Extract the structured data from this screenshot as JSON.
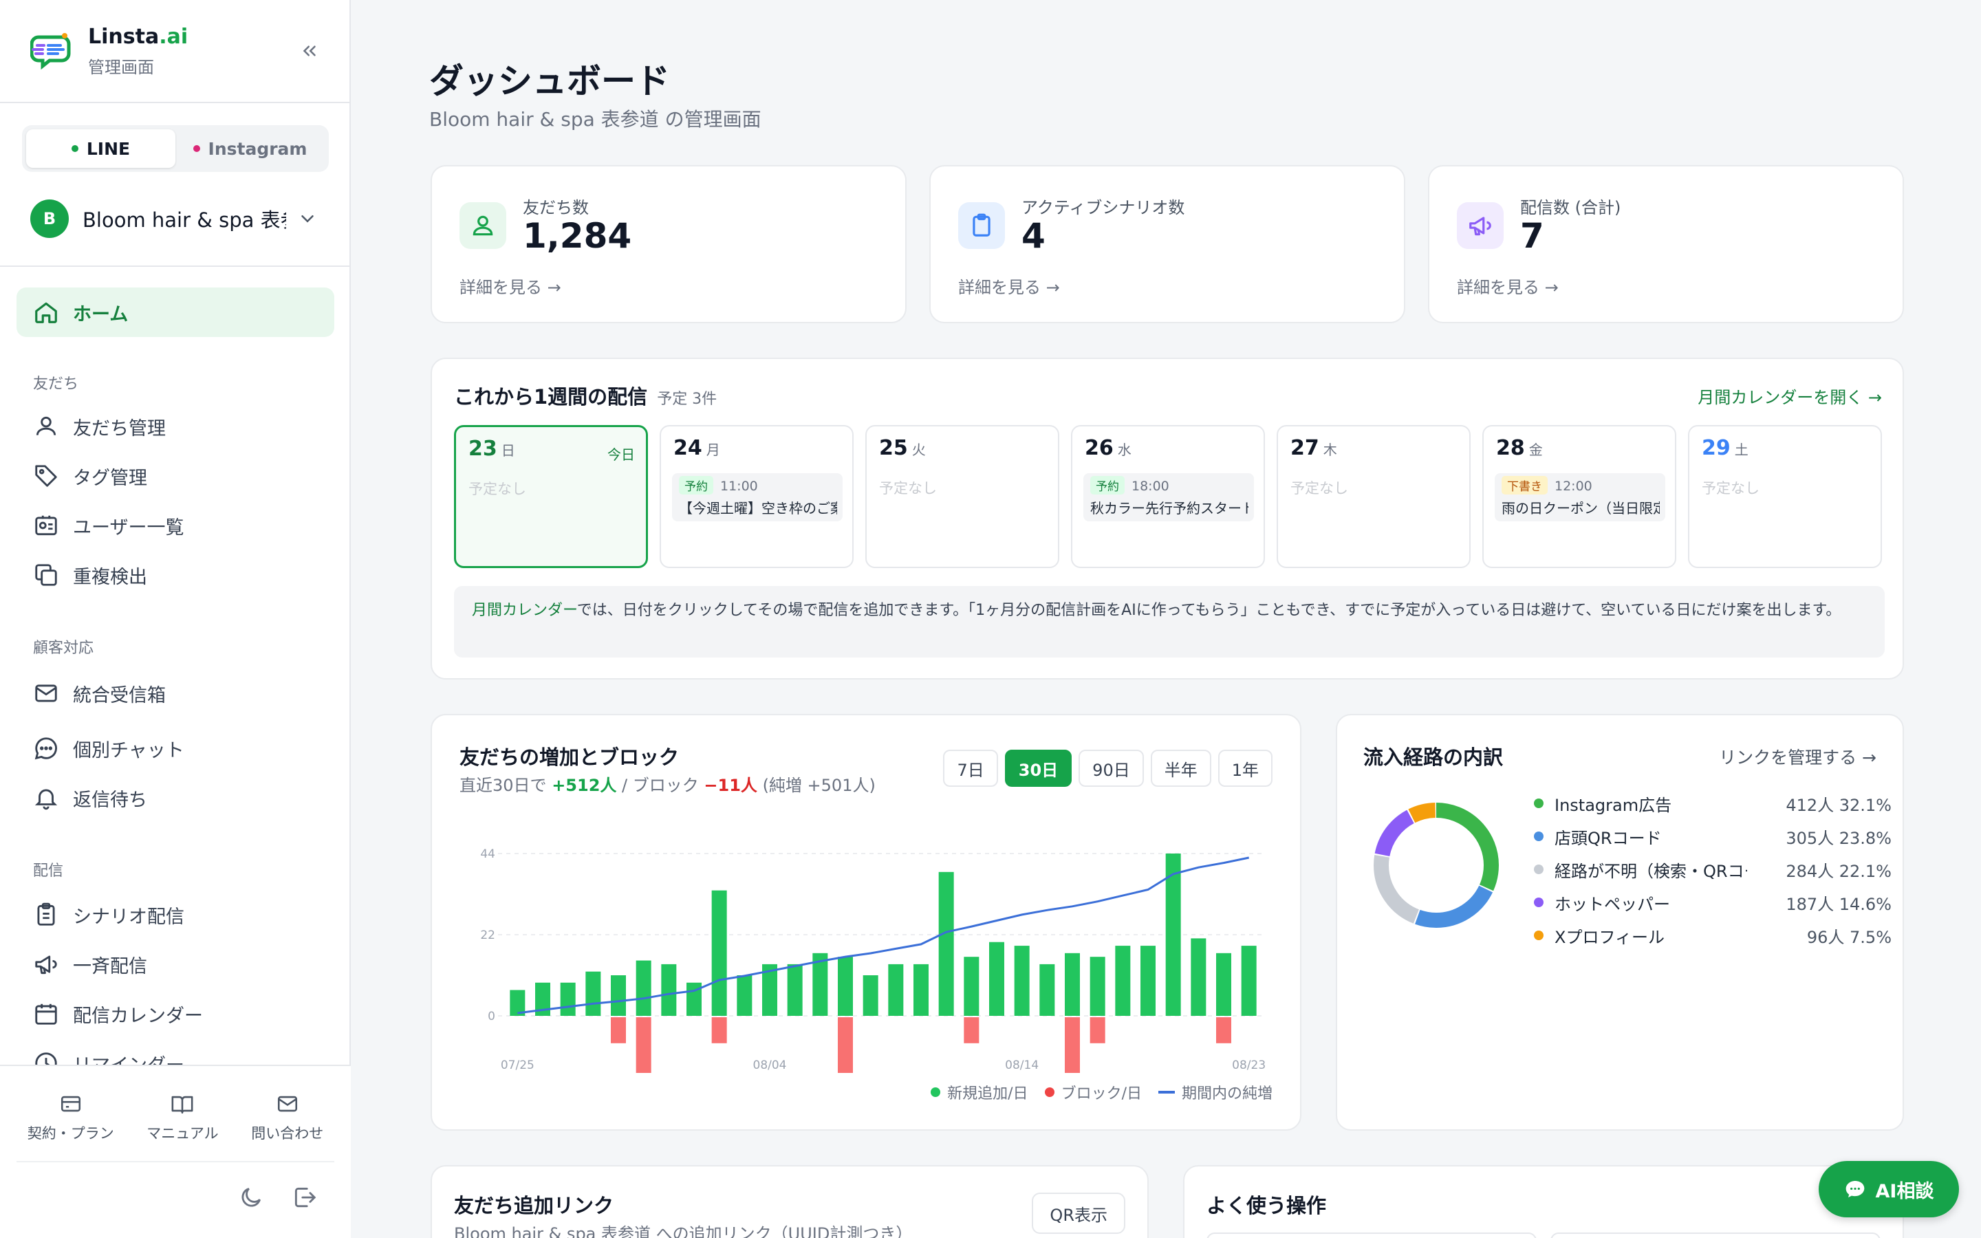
{
  "brand": {
    "name": "Linsta",
    "name_suffix": ".ai",
    "subtitle": "管理画面"
  },
  "channels": [
    {
      "label": "LINE",
      "color": "#16a34a"
    },
    {
      "label": "Instagram",
      "color": "#db2777"
    }
  ],
  "account": {
    "initial": "B",
    "name": "Bloom hair & spa 表参道"
  },
  "nav": {
    "home": "ホーム",
    "sections": {
      "friends": "友だち",
      "support": "顧客対応",
      "delivery": "配信"
    },
    "items": {
      "friend_manage": "友だち管理",
      "tag_manage": "タグ管理",
      "user_list": "ユーザー一覧",
      "duplicate": "重複検出",
      "inbox": "統合受信箱",
      "chat": "個別チャット",
      "waiting": "返信待ち",
      "scenario": "シナリオ配信",
      "broadcast": "一斉配信",
      "calendar": "配信カレンダー",
      "reminder": "リマインダー"
    }
  },
  "footer": {
    "contract": "契約・プラン",
    "manual": "マニュアル",
    "contact": "問い合わせ"
  },
  "page": {
    "title": "ダッシュボード",
    "subtitle": "Bloom hair & spa 表参道 の管理画面"
  },
  "stats": [
    {
      "label": "友だち数",
      "value": "1,284",
      "link": "詳細を見る →",
      "icon": "users-icon",
      "color": "#16a34a"
    },
    {
      "label": "アクティブシナリオ数",
      "value": "4",
      "link": "詳細を見る →",
      "icon": "clipboard-icon",
      "color": "#3b82f6"
    },
    {
      "label": "配信数 (合計)",
      "value": "7",
      "link": "詳細を見る →",
      "icon": "megaphone-icon",
      "color": "#8b5cf6"
    }
  ],
  "week": {
    "title": "これから1週間の配信",
    "meta": "予定 3件",
    "calendar_link": "月間カレンダーを開く →",
    "today_label": "今日",
    "empty_label": "予定なし",
    "days": [
      {
        "num": "23",
        "dow": "日",
        "today": true,
        "num_color": "#15803d"
      },
      {
        "num": "24",
        "dow": "月",
        "event": {
          "tag": "予約",
          "type": "yoyaku",
          "time": "11:00",
          "title": "【今週土曜】空き枠のご案内"
        }
      },
      {
        "num": "25",
        "dow": "火"
      },
      {
        "num": "26",
        "dow": "水",
        "event": {
          "tag": "予約",
          "type": "yoyaku",
          "time": "18:00",
          "title": "秋カラー先行予約スタート"
        }
      },
      {
        "num": "27",
        "dow": "木"
      },
      {
        "num": "28",
        "dow": "金",
        "event": {
          "tag": "下書き",
          "type": "draft",
          "time": "12:00",
          "title": "雨の日クーポン（当日限定）"
        }
      },
      {
        "num": "29",
        "dow": "土",
        "num_color": "#3b82f6"
      }
    ],
    "info": {
      "link": "月間カレンダー",
      "text": "では、日付をクリックしてその場で配信を追加できます。「1ヶ月分の配信計画をAIに作ってもらう」こともでき、すでに予定が入っている日は避けて、空いている日にだけ案を出します。"
    }
  },
  "growth": {
    "title": "友だちの増加とブロック",
    "summary_prefix": "直近30日で",
    "added": "+512人",
    "block_prefix": "/ ブロック",
    "blocked": "−11人",
    "net": "(純増 +501人)",
    "ranges": [
      "7日",
      "30日",
      "90日",
      "半年",
      "1年"
    ],
    "active_range": "30日",
    "legend": {
      "added": "新規追加/日",
      "blocked": "ブロック/日",
      "net": "期間内の純増"
    }
  },
  "sources": {
    "title": "流入経路の内訳",
    "link": "リンクを管理する →",
    "items": [
      {
        "name": "Instagram広告",
        "value": "412人 32.1%",
        "color": "#3bb54a",
        "pct": 32.1
      },
      {
        "name": "店頭QRコード",
        "value": "305人 23.8%",
        "color": "#4a8fe0",
        "pct": 23.8
      },
      {
        "name": "経路が不明（検索・QRコード等）",
        "value": "284人 22.1%",
        "color": "#c7ccd3",
        "pct": 22.1
      },
      {
        "name": "ホットペッパー",
        "value": "187人 14.6%",
        "color": "#8b5cf6",
        "pct": 14.6
      },
      {
        "name": "Xプロフィール",
        "value": "96人 7.5%",
        "color": "#f59e0b",
        "pct": 7.5
      }
    ]
  },
  "links_card": {
    "title": "友だち追加リンク",
    "subtitle": "Bloom hair & spa 表参道 への追加リンク（UUID計測つき）",
    "qr_button": "QR表示"
  },
  "quick_ops": {
    "title": "よく使う操作"
  },
  "ai_button": "AI相談",
  "chart_data": {
    "type": "bar",
    "categories": [
      "07/25",
      "07/26",
      "07/27",
      "07/28",
      "07/29",
      "07/30",
      "07/31",
      "08/01",
      "08/02",
      "08/03",
      "08/04",
      "08/05",
      "08/06",
      "08/07",
      "08/08",
      "08/09",
      "08/10",
      "08/11",
      "08/12",
      "08/13",
      "08/14",
      "08/15",
      "08/16",
      "08/17",
      "08/18",
      "08/19",
      "08/20",
      "08/21",
      "08/22",
      "08/23"
    ],
    "x_tick_labels": [
      "07/25",
      "08/04",
      "08/14",
      "08/23"
    ],
    "series": [
      {
        "name": "新規追加/日",
        "color": "#22c55e",
        "values": [
          7,
          9,
          9,
          12,
          11,
          15,
          14,
          9,
          34,
          11,
          14,
          14,
          17,
          16,
          11,
          14,
          14,
          39,
          16,
          20,
          19,
          14,
          17,
          16,
          19,
          19,
          44,
          21,
          17,
          19
        ]
      },
      {
        "name": "ブロック/日",
        "color": "#f87171",
        "values": [
          0,
          0,
          0,
          0,
          -7,
          -15,
          0,
          0,
          -7,
          0,
          0,
          0,
          0,
          -15,
          0,
          0,
          0,
          0,
          -7,
          0,
          0,
          0,
          -15,
          -7,
          0,
          0,
          0,
          0,
          -7,
          0
        ]
      },
      {
        "name": "期間内の純増",
        "color": "#3b6fd8",
        "type": "line",
        "values": [
          0.8,
          1.7,
          2.6,
          3.5,
          4.2,
          5.0,
          6.3,
          7.2,
          10.3,
          11.5,
          12.9,
          14.3,
          15.7,
          17.0,
          18.0,
          19.3,
          20.6,
          24.1,
          25.7,
          27.4,
          29.1,
          30.4,
          31.5,
          32.9,
          34.6,
          36.3,
          40.8,
          42.7,
          44.0,
          45.5
        ]
      }
    ],
    "yticks": [
      0,
      22,
      44
    ],
    "ylim": [
      -15,
      44
    ],
    "grid": true,
    "legend": "bottom-right"
  }
}
